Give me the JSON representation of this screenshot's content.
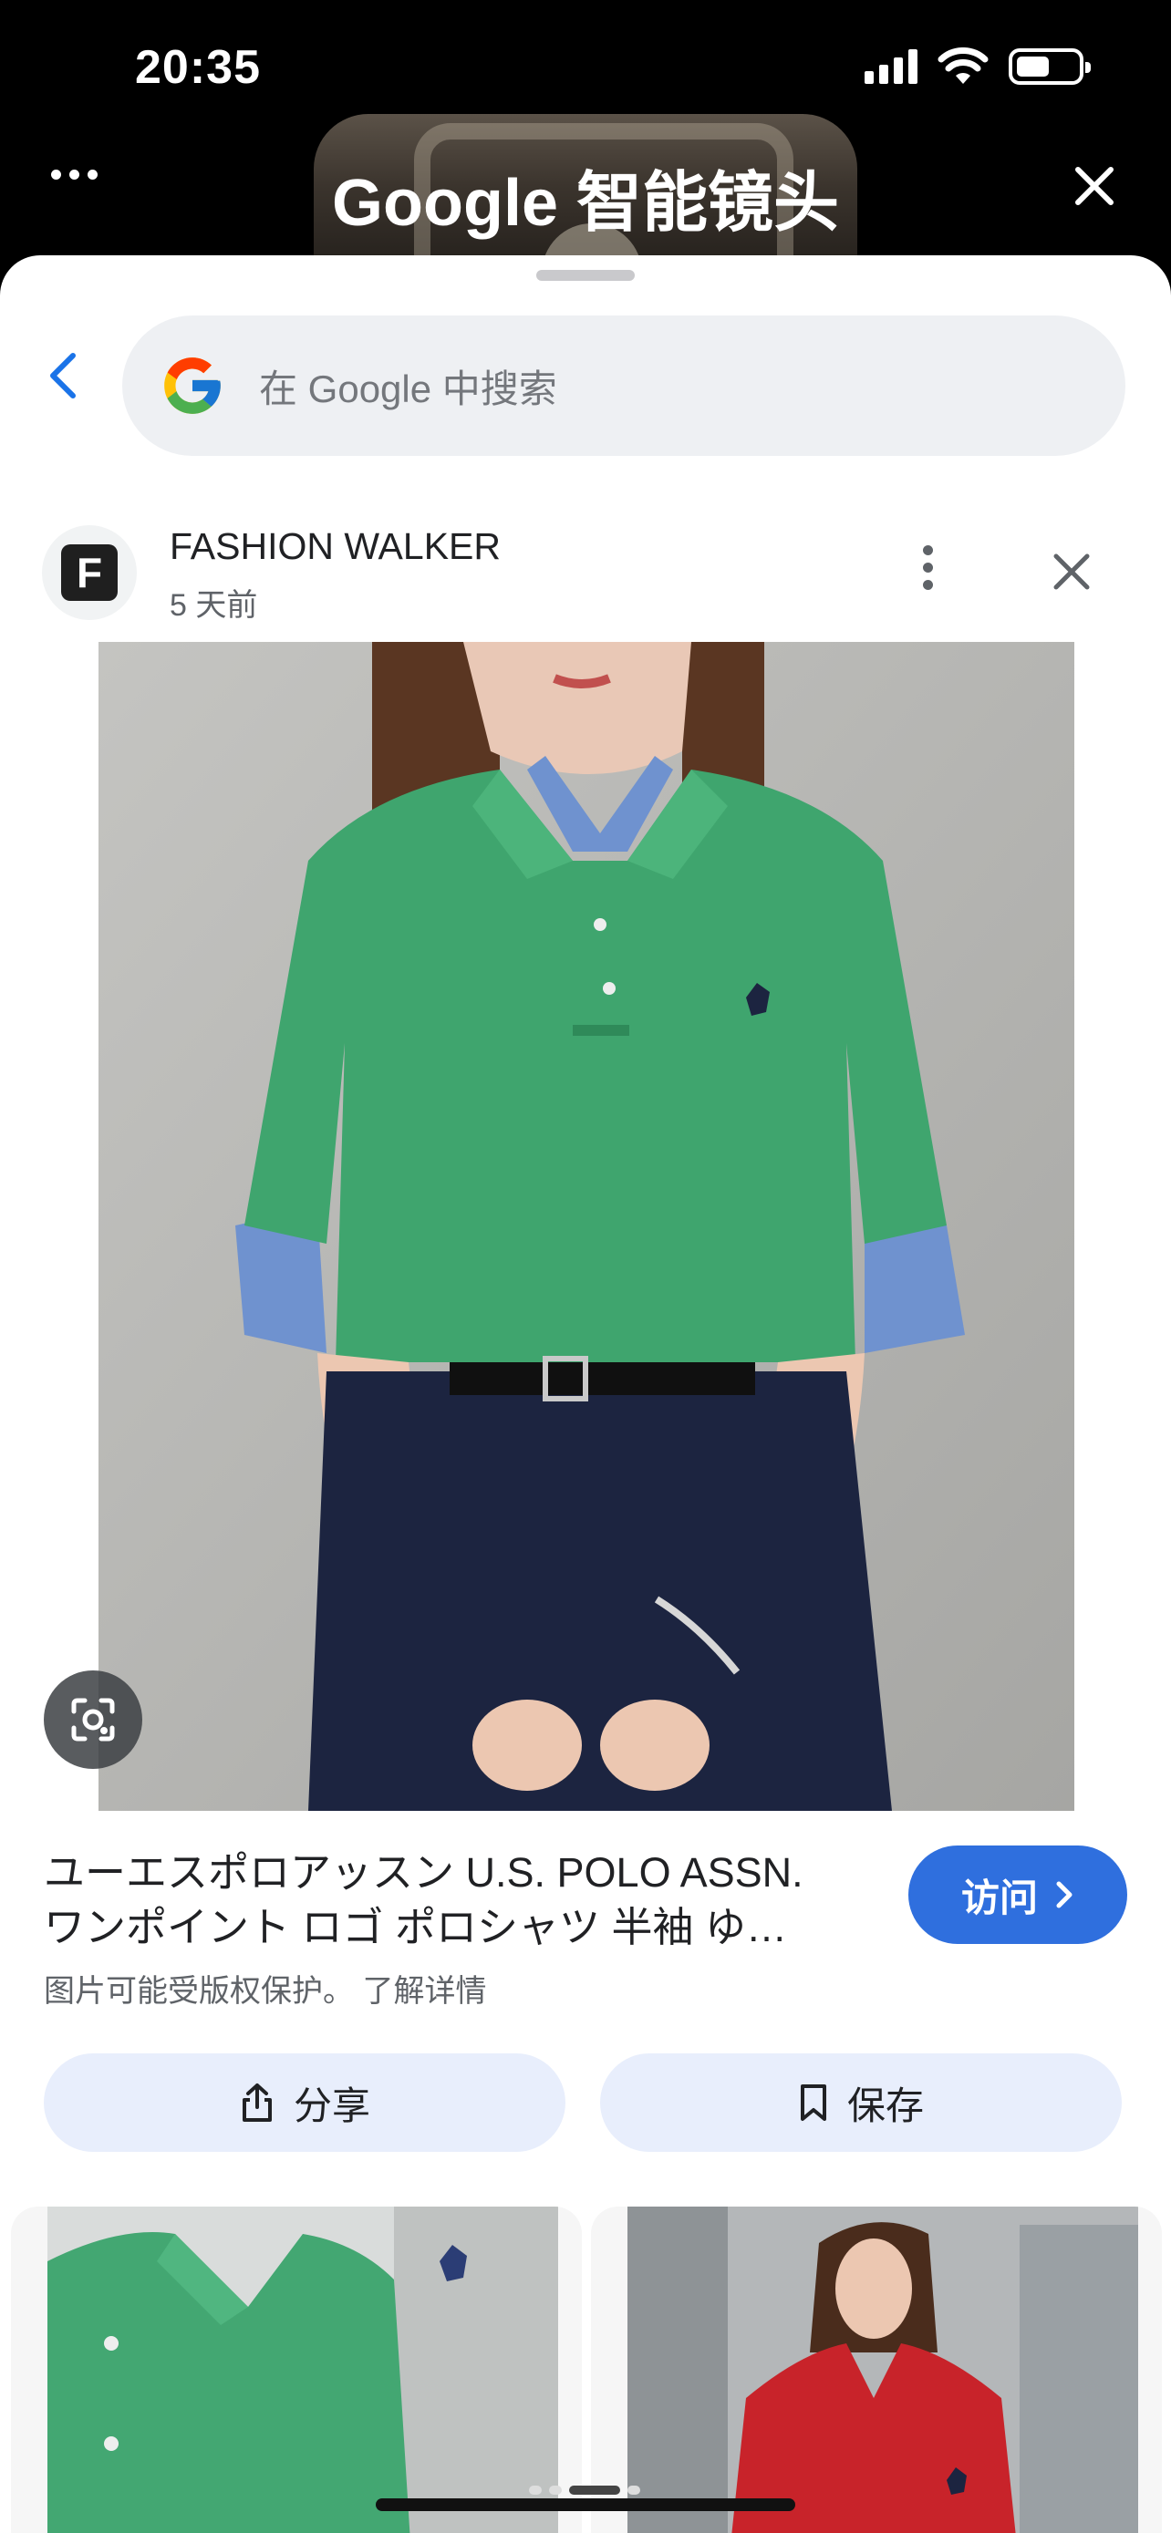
{
  "status_bar": {
    "time": "20:35",
    "icons": [
      "signal-icon",
      "wifi-icon",
      "battery-icon"
    ],
    "battery_level": 0.55
  },
  "header": {
    "title": "Google 智能镜头",
    "more_icon": "more-horizontal-icon",
    "close_icon": "close-icon"
  },
  "search": {
    "placeholder": "在 Google 中搜索",
    "back_icon": "chevron-left-icon",
    "logo_icon": "google-g-icon"
  },
  "source": {
    "avatar_letter": "F",
    "name": "FASHION WALKER",
    "time": "5 天前",
    "menu_icon": "more-vertical-icon",
    "close_icon": "close-icon"
  },
  "result": {
    "title_line1": "ユーエスポロアッスン U.S. POLO ASSN.",
    "title_line2": "ワンポイント ロゴ ポロシャツ 半袖 ゆ…",
    "copyright_text": "图片可能受版权保护。",
    "learn_more": "了解详情",
    "visit_label": "访问",
    "visit_icon": "chevron-right-icon",
    "lens_icon": "lens-search-icon"
  },
  "actions": {
    "share_label": "分享",
    "share_icon": "share-icon",
    "save_label": "保存",
    "save_icon": "bookmark-icon"
  },
  "thumbnails": [
    {
      "desc_icon": "image-thumbnail-green-polo"
    },
    {
      "desc_icon": "image-thumbnail-red-polo"
    }
  ],
  "colors": {
    "accent": "#2f6fde",
    "action_bg": "#e8eefc",
    "shirt_green": "#3fa56e",
    "shirt_red": "#c8232a",
    "pants_navy": "#1c2440",
    "undershirt_blue": "#6f92cf"
  }
}
